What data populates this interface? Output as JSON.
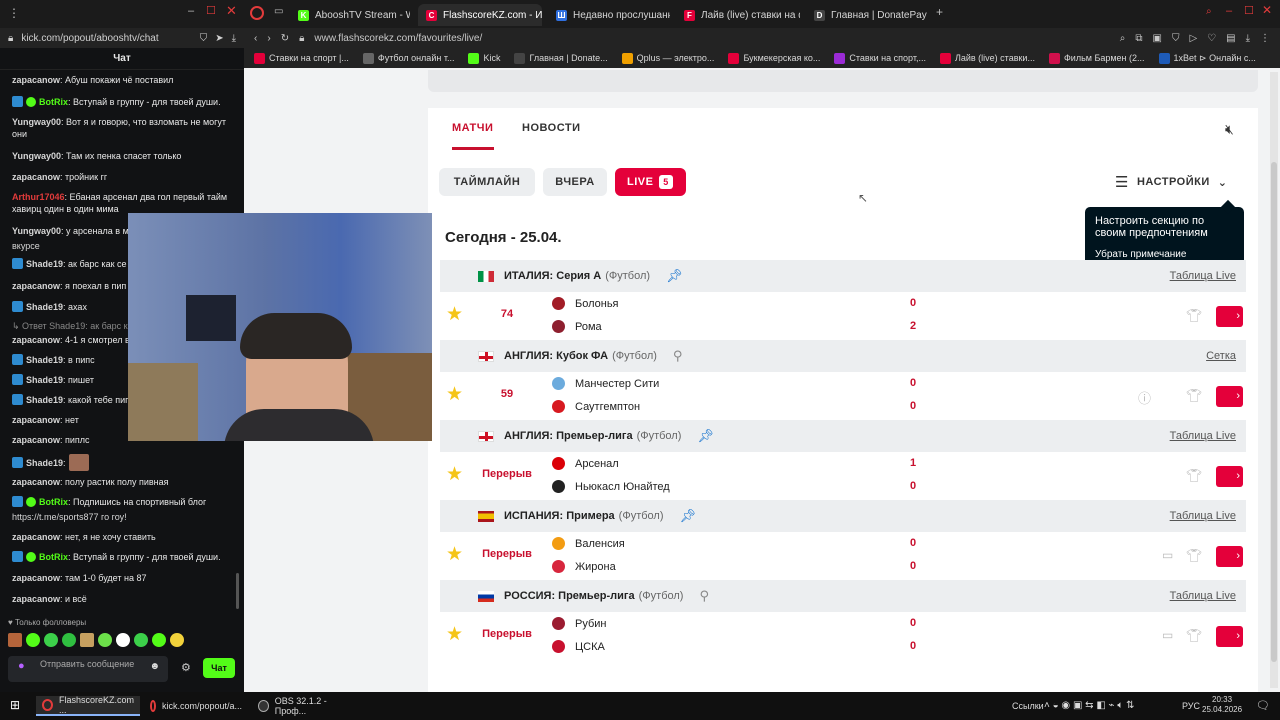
{
  "browser": {
    "tabs": [
      {
        "label": "AbooshTV Stream - Watch",
        "color": "#53fc18",
        "glyph": "K"
      },
      {
        "label": "FlashscoreKZ.com - Избр",
        "color": "#e4003a",
        "glyph": "C"
      },
      {
        "label": "Недавно прослушанные",
        "color": "#2f6fde",
        "glyph": "Ш"
      },
      {
        "label": "Лайв (live) ставки на фут",
        "color": "#e4003a",
        "glyph": "F"
      },
      {
        "label": "Главная | DonatePay",
        "color": "#444",
        "glyph": "D"
      }
    ],
    "left_url": "kick.com/popout/abooshtv/chat",
    "url": "www.flashscorekz.com/favourites/live/",
    "bookmarks": [
      {
        "label": "Ставки на спорт |...",
        "color": "#e4003a"
      },
      {
        "label": "Футбол онлайн т...",
        "color": "#666"
      },
      {
        "label": "Kick",
        "color": "#53fc18"
      },
      {
        "label": "Главная | Donate...",
        "color": "#444"
      },
      {
        "label": "Qplus — электро...",
        "color": "#f0a000"
      },
      {
        "label": "Букмекерская ко...",
        "color": "#e4003a"
      },
      {
        "label": "Ставки на спорт,...",
        "color": "#9b2bd6"
      },
      {
        "label": "Лайв (live) ставки...",
        "color": "#e4003a"
      },
      {
        "label": "Фильм Бармен (2...",
        "color": "#d0104c"
      },
      {
        "label": "1xBet ⊳ Онлайн с...",
        "color": "#1e5bb8"
      }
    ]
  },
  "chat": {
    "title": "Чат",
    "messages": [
      {
        "user": "zapacanow",
        "user_color": "#d6d6d6",
        "text": ": Абуш покажи чё поставил"
      },
      {
        "user": "BotRix",
        "user_color": "#53fc18",
        "text": ": Вступай в группу - для твоей души."
      },
      {
        "user": "Yungway00",
        "user_color": "#d6d6d6",
        "text": ": Вот я и говорю, что взломать не могут они"
      },
      {
        "user": "Yungway00",
        "user_color": "#d6d6d6",
        "text": ": Там их пенка спасет только"
      },
      {
        "user": "zapacanow",
        "user_color": "#d6d6d6",
        "text": ": тройник гг"
      },
      {
        "user": "Arthur17046",
        "user_color": "#e23b3b",
        "text": ": Ебаная арсенал два гол первый тайм хавирц один в один мима"
      },
      {
        "user": "Yungway00",
        "user_color": "#d6d6d6",
        "text": ": у арсенала в м"
      },
      {
        "user": "",
        "user_color": "#d6d6d6",
        "text": "вкурсе"
      },
      {
        "user": "Shade19",
        "user_color": "#d6d6d6",
        "text": ": ак барс как се"
      },
      {
        "user": "zapacanow",
        "user_color": "#d6d6d6",
        "text": ": я поехал в пип"
      },
      {
        "user": "Shade19",
        "user_color": "#d6d6d6",
        "text": ": ахах"
      },
      {
        "user": "",
        "user_color": "#888",
        "text": "↳ Ответ Shade19: ак барс как"
      },
      {
        "user": "zapacanow",
        "user_color": "#d6d6d6",
        "text": ": 4-1 я смотрел в"
      },
      {
        "user": "Shade19",
        "user_color": "#d6d6d6",
        "text": ": в пипс"
      },
      {
        "user": "Shade19",
        "user_color": "#d6d6d6",
        "text": ": пишет"
      },
      {
        "user": "Shade19",
        "user_color": "#d6d6d6",
        "text": ": какой тебе пип"
      },
      {
        "user": "zapacanow",
        "user_color": "#d6d6d6",
        "text": ": нет"
      },
      {
        "user": "zapacanow",
        "user_color": "#d6d6d6",
        "text": ": пиплс"
      },
      {
        "user": "Shade19",
        "user_color": "#d6d6d6",
        "text": ":"
      },
      {
        "user": "zapacanow",
        "user_color": "#d6d6d6",
        "text": ": полу растик полу пивная"
      },
      {
        "user": "BotRix",
        "user_color": "#53fc18",
        "text": ": Подпишись на спортивный блог"
      },
      {
        "user": "",
        "user_color": "#d6d6d6",
        "text": "https://t.me/sports877 го гоу!"
      },
      {
        "user": "zapacanow",
        "user_color": "#d6d6d6",
        "text": ": нет, я не хочу ставить"
      },
      {
        "user": "BotRix",
        "user_color": "#53fc18",
        "text": ": Вступай в группу - для твоей души."
      },
      {
        "user": "zapacanow",
        "user_color": "#d6d6d6",
        "text": ": там 1-0 будет на 87"
      },
      {
        "user": "zapacanow",
        "user_color": "#d6d6d6",
        "text": ": и всё"
      }
    ],
    "followers_only": "Только фолловеры",
    "input_placeholder": "Отправить сообщение",
    "send_label": "Чат"
  },
  "flashscore": {
    "nav_tabs": [
      "МАТЧИ",
      "НОВОСТИ"
    ],
    "filters": [
      "ТАЙМЛАЙН",
      "ВЧЕРА",
      "LIVE"
    ],
    "live_count": "5",
    "settings_label": "НАСТРОЙКИ",
    "tooltip_text": "Настроить секцию по своим предпочтениям",
    "tooltip_link": "Убрать примечание",
    "date_heading": "Сегодня - 25.04.",
    "leagues": [
      {
        "country": "ИТАЛИЯ",
        "name": ": Серия А",
        "sport": "(Футбол)",
        "link": "Таблица Live",
        "pinned": true,
        "match": {
          "time": "74",
          "home": "Болонья",
          "away": "Рома",
          "home_score": "0",
          "away_score": "2",
          "home_color": "#a21c26",
          "away_color": "#8e1f2f",
          "tv": false,
          "info": false
        }
      },
      {
        "country": "АНГЛИЯ",
        "name": ": Кубок ФА",
        "sport": "(Футбол)",
        "link": "Сетка",
        "pinned": false,
        "match": {
          "time": "59",
          "home": "Манчестер Сити",
          "away": "Саутгемптон",
          "home_score": "0",
          "away_score": "0",
          "home_color": "#6cabdd",
          "away_color": "#d71920",
          "tv": false,
          "info": true
        }
      },
      {
        "country": "АНГЛИЯ",
        "name": ": Премьер-лига",
        "sport": "(Футбол)",
        "link": "Таблица Live",
        "pinned": true,
        "match": {
          "time": "Перерыв",
          "home": "Арсенал",
          "away": "Ньюкасл Юнайтед",
          "home_score": "1",
          "away_score": "0",
          "home_color": "#db0007",
          "away_color": "#222222",
          "tv": false,
          "info": false
        }
      },
      {
        "country": "ИСПАНИЯ",
        "name": ": Примера",
        "sport": "(Футбол)",
        "link": "Таблица Live",
        "pinned": true,
        "match": {
          "time": "Перерыв",
          "home": "Валенсия",
          "away": "Жирона",
          "home_score": "0",
          "away_score": "0",
          "home_color": "#f39c12",
          "away_color": "#d7263d",
          "tv": true,
          "info": false
        }
      },
      {
        "country": "РОССИЯ",
        "name": ": Премьер-лига",
        "sport": "(Футбол)",
        "link": "Таблица Live",
        "pinned": false,
        "match": {
          "time": "Перерыв",
          "home": "Рубин",
          "away": "ЦСКА",
          "home_score": "0",
          "away_score": "0",
          "home_color": "#9b1b30",
          "away_color": "#c8102e",
          "tv": true,
          "info": false
        }
      }
    ]
  },
  "taskbar": {
    "apps": [
      "FlashscoreKZ.com ...",
      "kick.com/popout/a...",
      "OBS 32.1.2 - Проф..."
    ],
    "links_label": "Ссылки",
    "lang": "РУС",
    "time": "20:33",
    "date": "25.04.2026"
  }
}
